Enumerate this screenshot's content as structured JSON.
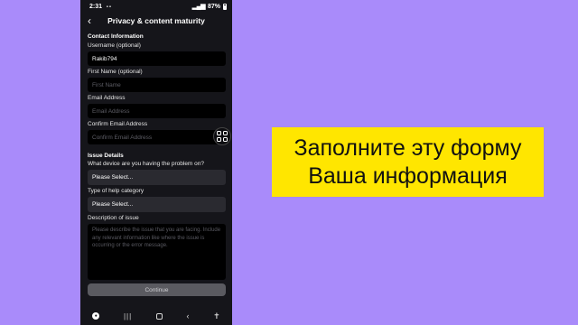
{
  "status_bar": {
    "time": "2:31",
    "dots": "• •",
    "battery": "87%"
  },
  "header": {
    "title": "Privacy & content maturity"
  },
  "contact": {
    "section_title": "Contact Information",
    "username_label": "Username (optional)",
    "username_value": "Rakib794",
    "first_name_label": "First Name (optional)",
    "first_name_placeholder": "First Name",
    "email_label": "Email Address",
    "email_placeholder": "Email Address",
    "confirm_email_label": "Confirm Email Address",
    "confirm_email_placeholder": "Confirm Email Address"
  },
  "issue": {
    "section_title": "Issue Details",
    "device_label": "What device are you having the problem on?",
    "device_value": "Please Select...",
    "category_label": "Type of help category",
    "category_value": "Please Select...",
    "description_label": "Description of issue",
    "description_placeholder": "Please describe the issue that you are facing. Include any relevant information like where the issue is occurring or the error message."
  },
  "actions": {
    "continue_label": "Continue"
  },
  "overlay": {
    "line1": "Заполните эту форму",
    "line2": "Ваша информация"
  },
  "colors": {
    "background": "#a98bfa",
    "banner": "#ffe600",
    "phone": "#15151a"
  },
  "icons": [
    "back-arrow-icon",
    "qr-scan-icon",
    "recents-icon",
    "home-icon",
    "back-icon",
    "accessibility-icon"
  ]
}
